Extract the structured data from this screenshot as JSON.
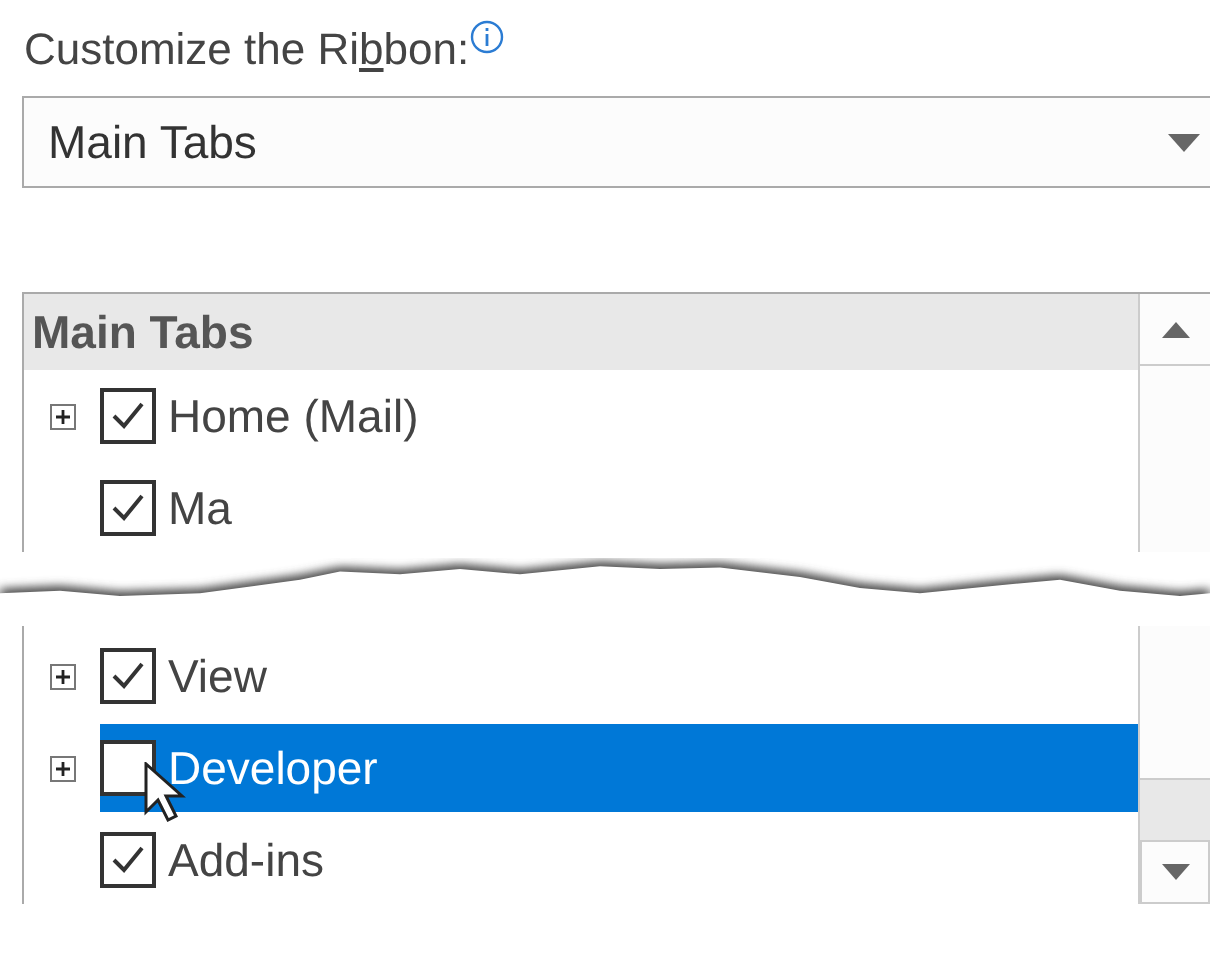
{
  "label": {
    "text": "Customize the Ri",
    "accel": "b",
    "rest": "bon:"
  },
  "dropdown": {
    "value": "Main Tabs"
  },
  "tree": {
    "header": "Main Tabs",
    "top_items": [
      {
        "label": "Home (Mail)",
        "checked": true,
        "selected": false,
        "expandable": true
      },
      {
        "label": "Ma",
        "checked": true,
        "selected": false,
        "expandable": false
      }
    ],
    "bottom_items": [
      {
        "label": "View",
        "checked": true,
        "selected": false,
        "expandable": true
      },
      {
        "label": "Developer",
        "checked": false,
        "selected": true,
        "expandable": true
      },
      {
        "label": "Add-ins",
        "checked": true,
        "selected": false,
        "expandable": false
      }
    ]
  }
}
